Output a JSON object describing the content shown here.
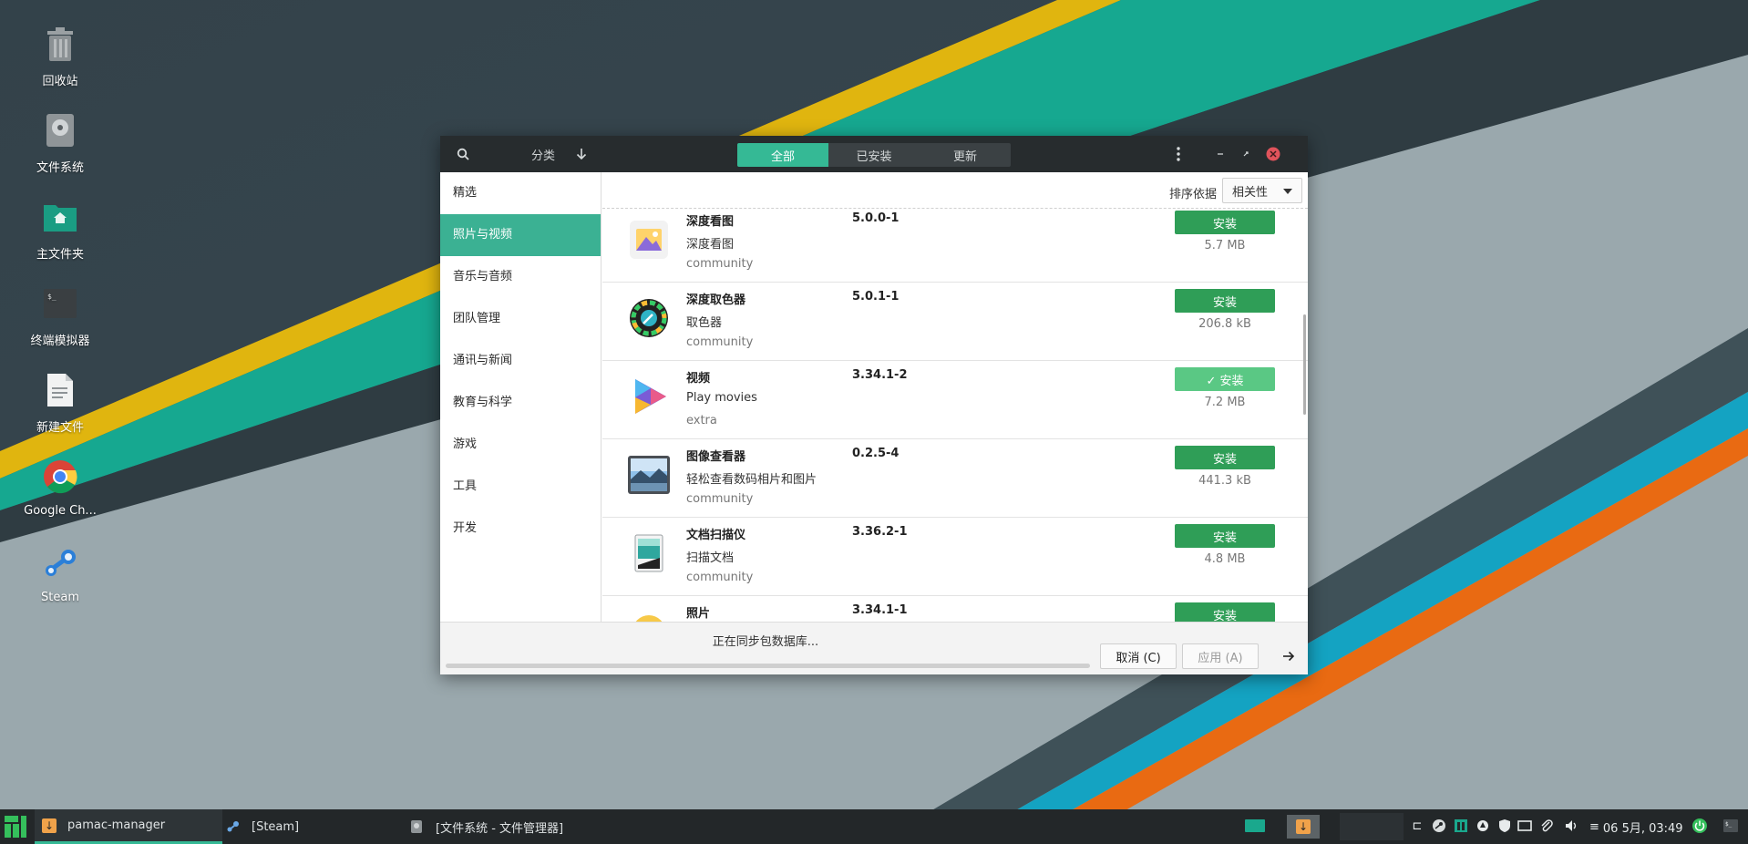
{
  "desktop": {
    "icons": [
      {
        "label": "回收站",
        "icon": "trash-icon"
      },
      {
        "label": "文件系统",
        "icon": "drive-icon"
      },
      {
        "label": "主文件夹",
        "icon": "home-folder-icon"
      },
      {
        "label": "终端模拟器",
        "icon": "terminal-icon"
      },
      {
        "label": "新建文件",
        "icon": "document-icon"
      },
      {
        "label": "Google Ch...",
        "icon": "chrome-icon"
      },
      {
        "label": "Steam",
        "icon": "steam-icon"
      }
    ]
  },
  "window": {
    "titlebar": {
      "categories_label": "分类",
      "tabs": [
        {
          "label": "全部",
          "active": true
        },
        {
          "label": "已安装",
          "active": false
        },
        {
          "label": "更新",
          "active": false
        }
      ]
    },
    "sidebar": {
      "items": [
        {
          "label": "精选",
          "active": false
        },
        {
          "label": "照片与视频",
          "active": true
        },
        {
          "label": "音乐与音频",
          "active": false
        },
        {
          "label": "团队管理",
          "active": false
        },
        {
          "label": "通讯与新闻",
          "active": false
        },
        {
          "label": "教育与科学",
          "active": false
        },
        {
          "label": "游戏",
          "active": false
        },
        {
          "label": "工具",
          "active": false
        },
        {
          "label": "开发",
          "active": false
        }
      ]
    },
    "sort": {
      "label": "排序依据",
      "value": "相关性"
    },
    "packages": [
      {
        "name": "深度看图",
        "desc": "深度看图",
        "repo": "community",
        "version": "5.0.0-1",
        "button": "安装",
        "size": "5.7 MB",
        "checked": false,
        "icon": "image-viewer-icon"
      },
      {
        "name": "深度取色器",
        "desc": "取色器",
        "repo": "community",
        "version": "5.0.1-1",
        "button": "安装",
        "size": "206.8 kB",
        "checked": false,
        "icon": "color-picker-icon"
      },
      {
        "name": "视频",
        "desc": "Play movies",
        "repo": "extra",
        "version": "3.34.1-2",
        "button": "✓ 安装",
        "size": "7.2 MB",
        "checked": true,
        "icon": "video-play-icon"
      },
      {
        "name": "图像查看器",
        "desc": "轻松查看数码相片和图片",
        "repo": "community",
        "version": "0.2.5-4",
        "button": "安装",
        "size": "441.3 kB",
        "checked": false,
        "icon": "photo-landscape-icon"
      },
      {
        "name": "文档扫描仪",
        "desc": "扫描文档",
        "repo": "community",
        "version": "3.36.2-1",
        "button": "安装",
        "size": "4.8 MB",
        "checked": false,
        "icon": "scanner-icon"
      },
      {
        "name": "照片",
        "desc": "",
        "repo": "",
        "version": "3.34.1-1",
        "button": "安装",
        "size": "",
        "checked": false,
        "icon": "photos-icon"
      }
    ],
    "footer": {
      "status": "正在同步包数据库...",
      "cancel": "取消 (C)",
      "apply": "应用 (A)"
    }
  },
  "taskbar": {
    "tasks": [
      {
        "label": "pamac-manager",
        "active": true
      },
      {
        "label": "[Steam]",
        "active": false
      },
      {
        "label": "[文件系统 - 文件管理器]",
        "active": false
      }
    ],
    "clock": "06 5月, 03:49"
  },
  "colors": {
    "accent": "#35b995",
    "install_button": "#2f9e57",
    "titlebar": "#272c2e",
    "taskbar": "#232729"
  }
}
